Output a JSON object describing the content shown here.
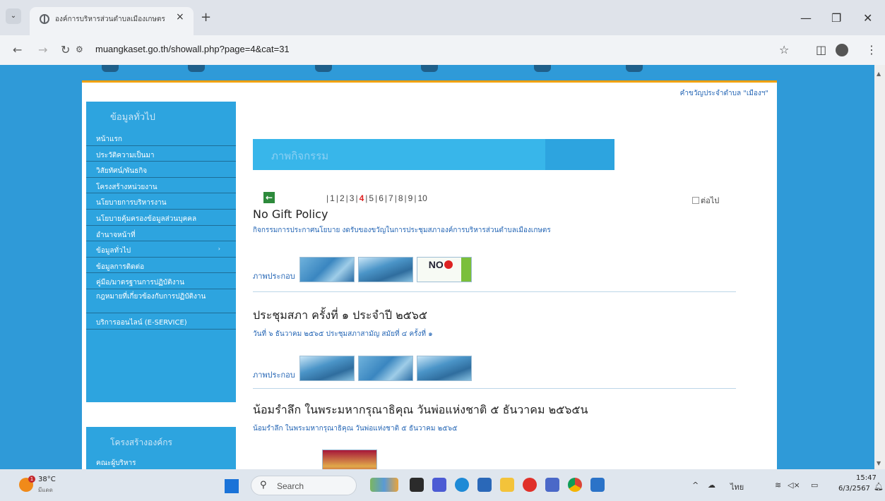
{
  "browser": {
    "tab_title": "องค์การบริหารส่วนตำบลเมืองเกษตร",
    "url": "muangkaset.go.th/showall.php?page=4&cat=31",
    "new_tab": "+",
    "close": "×"
  },
  "page": {
    "tagline": "คำขวัญประจำตำบล \"เมืองฯ\"",
    "sidebar": {
      "heading": "ข้อมูลทั่วไป",
      "items": [
        "หน้าแรก",
        "ประวัติความเป็นมา",
        "วิสัยทัศน์/พันธกิจ",
        "โครงสร้างหน่วยงาน",
        "นโยบายการบริหารงาน",
        "นโยบายคุ้มครองข้อมูลส่วนบุคคล",
        "อำนาจหน้าที่",
        "ข้อมูลทั่วไป",
        "ข้อมูลการติดต่อ",
        "คู่มือ/มาตรฐานการปฏิบัติงาน",
        "กฎหมายที่เกี่ยวข้องกับการปฏิบัติงาน",
        "บริการออนไลน์ (E-SERVICE)"
      ]
    },
    "sidebar2": {
      "heading": "โครงสร้างองค์กร",
      "first_item": "คณะผู้บริหาร"
    },
    "banner_title": "ภาพกิจกรรม",
    "pagination": {
      "pages": [
        "1",
        "2",
        "3",
        "4",
        "5",
        "6",
        "7",
        "8",
        "9",
        "10"
      ],
      "current": "4",
      "next_label": "ต่อไป"
    },
    "photo_label": "ภาพประกอบ",
    "items": [
      {
        "title": "No Gift Policy",
        "subtitle": "กิจกรรมการประกาศนโยบาย งดรับของขวัญในการประชุมสภาองค์การบริหารส่วนตำบลเมืองเกษตร",
        "poster_text": "NO"
      },
      {
        "title": "ประชุมสภา ครั้งที่ ๑ ประจำปี ๒๕๖๕",
        "subtitle": "วันที่ ๖ ธันวาคม ๒๕๖๕ ประชุมสภาสามัญ สมัยที่ ๔ ครั้งที่ ๑"
      },
      {
        "title": "น้อมรำลึก ในพระมหากรุณาธิคุณ วันพ่อแห่งชาติ ๕ ธันวาคม ๒๕๖๕น",
        "subtitle": "น้อมรำลึก ในพระมหากรุณาธิคุณ วันพ่อแห่งชาติ ๕ ธันวาคม ๒๕๖๕"
      }
    ]
  },
  "taskbar": {
    "weather_temp": "38°C",
    "weather_desc": "มีแดด",
    "weather_badge": "1",
    "search_placeholder": "Search",
    "lang": "ไทย",
    "time": "15:47",
    "date": "6/3/2567"
  }
}
